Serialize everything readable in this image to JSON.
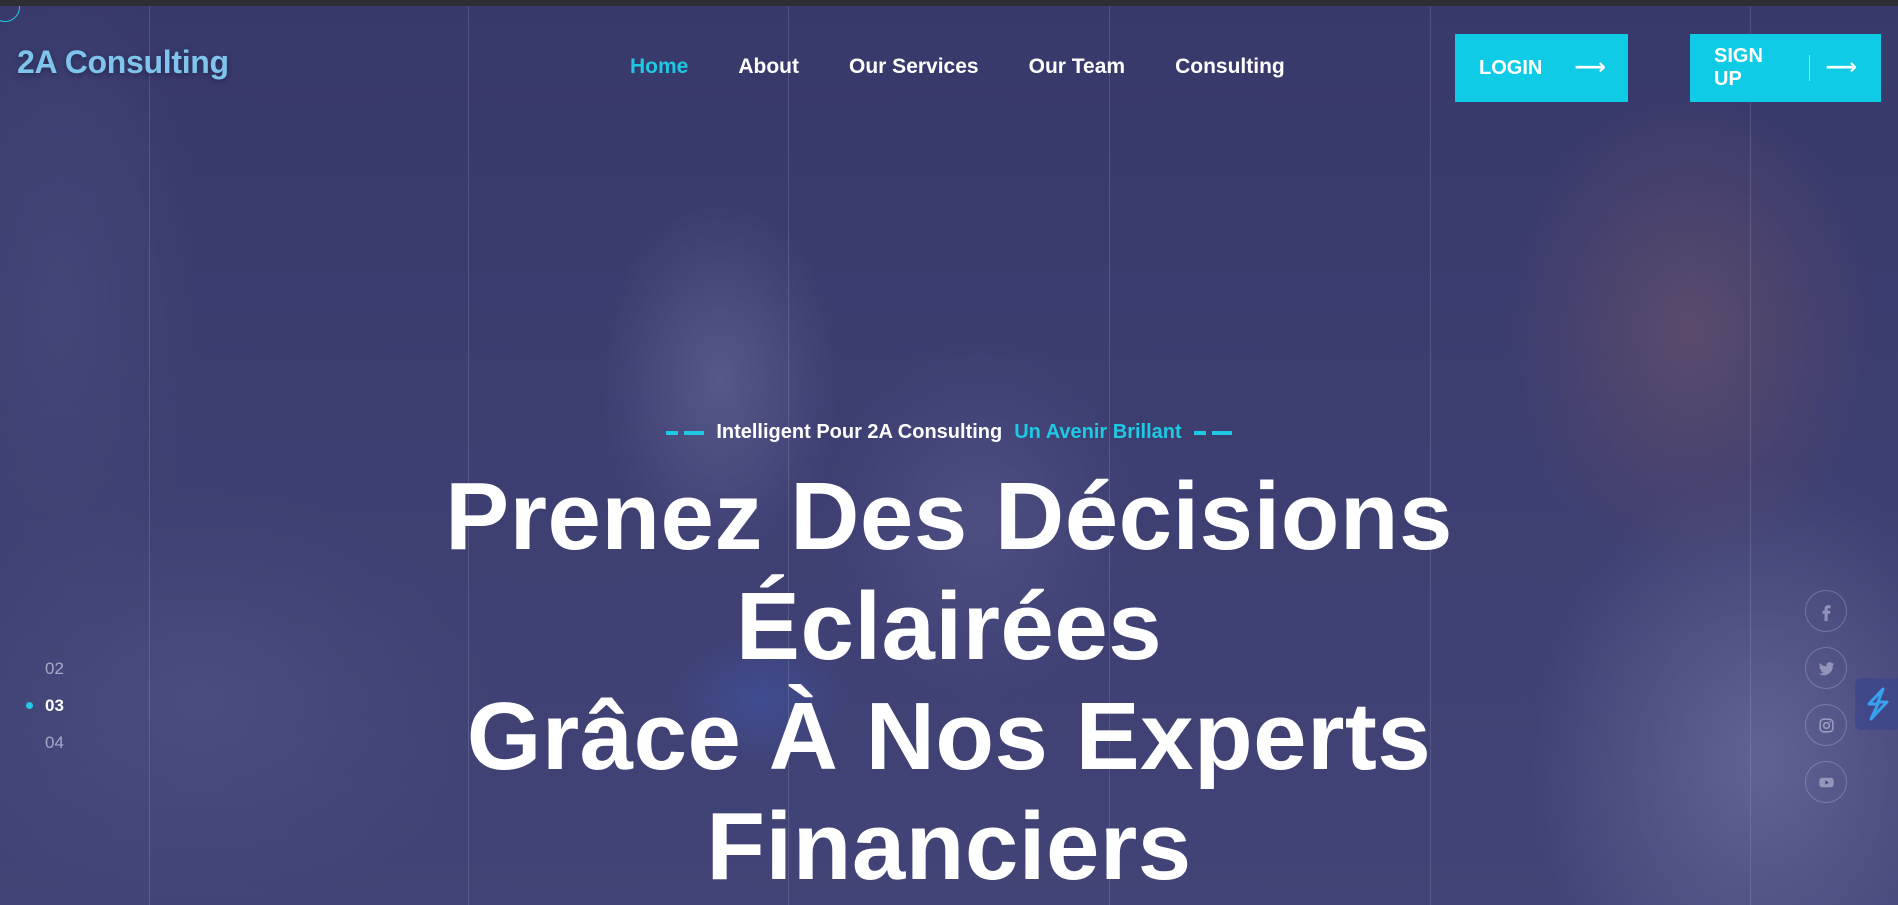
{
  "header": {
    "logo_text": "2A Consulting",
    "nav": [
      {
        "label": "Home",
        "active": true
      },
      {
        "label": "About",
        "active": false
      },
      {
        "label": "Our Services",
        "active": false
      },
      {
        "label": "Our Team",
        "active": false
      },
      {
        "label": "Consulting",
        "active": false
      }
    ],
    "login_label": "LOGIN",
    "signup_label": "SIGN UP"
  },
  "hero": {
    "tagline_main": "Intelligent Pour 2A Consulting",
    "tagline_accent": "Un Avenir Brillant",
    "headline_lines": [
      "Prenez Des Décisions",
      "Éclairées",
      "Grâce À Nos Experts",
      "Financiers"
    ]
  },
  "slides": {
    "items": [
      "02",
      "03",
      "04"
    ],
    "active": "03"
  },
  "social": [
    "facebook-icon",
    "twitter-icon",
    "instagram-icon",
    "youtube-icon"
  ],
  "colors": {
    "accent": "#1fc8e3",
    "button_bg": "#0fcbe6",
    "overlay": "#3c3d6e",
    "logo": "#7fc4ec"
  }
}
